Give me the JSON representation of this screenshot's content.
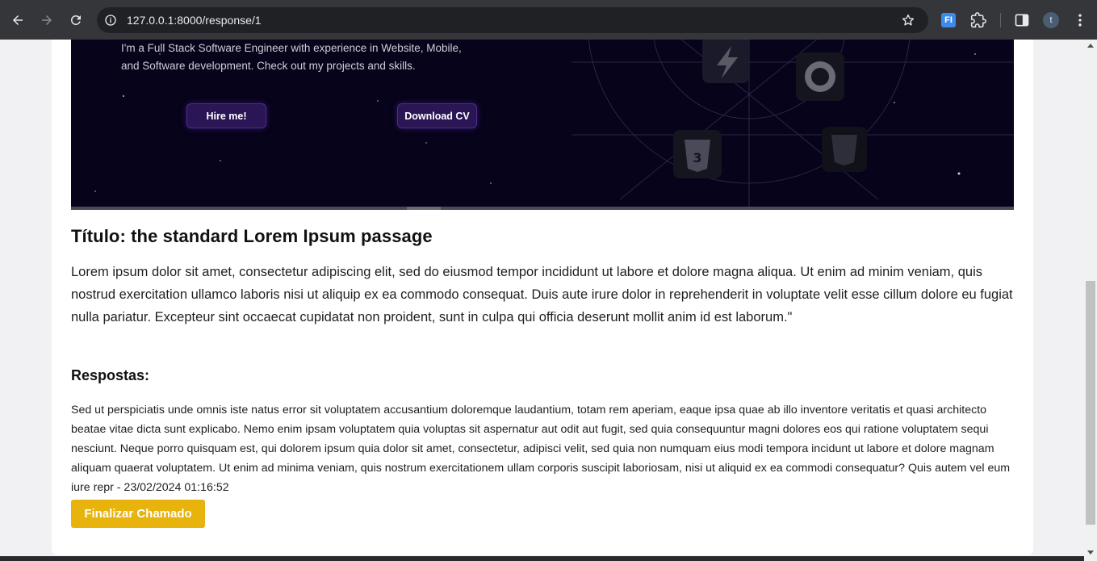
{
  "browser": {
    "url": "127.0.0.1:8000/response/1",
    "extension_badge": "FI",
    "profile_initial": "t"
  },
  "hero": {
    "intro_line1": "I'm a Full Stack Software Engineer with experience in Website, Mobile,",
    "intro_line2": "and Software development. Check out my projects and skills.",
    "hire_button": "Hire me!",
    "download_button": "Download CV"
  },
  "ticket": {
    "title": "Título: the standard Lorem Ipsum passage",
    "description": "Lorem ipsum dolor sit amet, consectetur adipiscing elit, sed do eiusmod tempor incididunt ut labore et dolore magna aliqua. Ut enim ad minim veniam, quis nostrud exercitation ullamco laboris nisi ut aliquip ex ea commodo consequat. Duis aute irure dolor in reprehenderit in voluptate velit esse cillum dolore eu fugiat nulla pariatur. Excepteur sint occaecat cupidatat non proident, sunt in culpa qui officia deserunt mollit anim id est laborum.\"",
    "responses_heading": "Respostas:",
    "response_text": "Sed ut perspiciatis unde omnis iste natus error sit voluptatem accusantium doloremque laudantium, totam rem aperiam, eaque ipsa quae ab illo inventore veritatis et quasi architecto beatae vitae dicta sunt explicabo. Nemo enim ipsam voluptatem quia voluptas sit aspernatur aut odit aut fugit, sed quia consequuntur magni dolores eos qui ratione voluptatem sequi nesciunt. Neque porro quisquam est, qui dolorem ipsum quia dolor sit amet, consectetur, adipisci velit, sed quia non numquam eius modi tempora incidunt ut labore et dolore magnam aliquam quaerat voluptatem. Ut enim ad minima veniam, quis nostrum exercitationem ullam corporis suscipit laboriosam, nisi ut aliquid ex ea commodi consequatur? Quis autem vel eum iure repr - 23/02/2024 01:16:52",
    "finalize_button": "Finalizar Chamado"
  },
  "colors": {
    "finalize_button": "#e8b30c",
    "hero_background": "#07031a",
    "chrome": "#35363a"
  },
  "icons": [
    "back-arrow-icon",
    "forward-arrow-icon",
    "reload-icon",
    "site-info-icon",
    "bookmark-star-icon",
    "extensions-puzzle-icon",
    "side-panel-icon",
    "menu-kebab-icon"
  ]
}
